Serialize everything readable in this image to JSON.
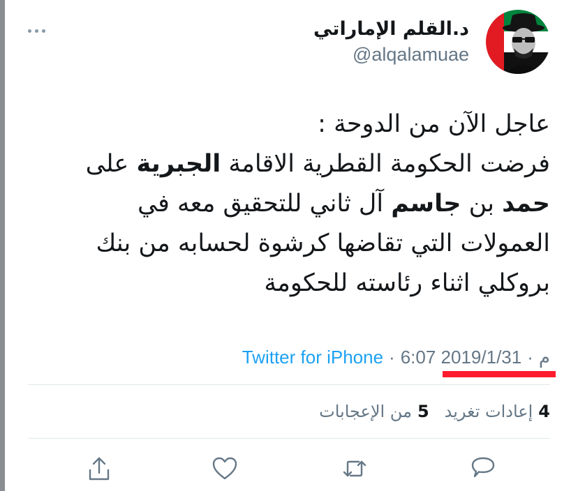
{
  "tweet": {
    "display_name": "د.القلم الإماراتي",
    "handle": "@alqalamuae",
    "text_lines": [
      [
        {
          "t": "عاجل الآن من الدوحة :",
          "b": false
        }
      ],
      [
        {
          "t": "فرضت الحكومة القطرية الاقامة ",
          "b": false
        },
        {
          "t": "الجبرية",
          "b": true
        },
        {
          "t": " على",
          "b": false
        }
      ],
      [
        {
          "t": "حمد",
          "b": true
        },
        {
          "t": " بن ",
          "b": false
        },
        {
          "t": "جاسم",
          "b": true
        },
        {
          "t": " آل ثاني للتحقيق معه في",
          "b": false
        }
      ],
      [
        {
          "t": "العمولات التي تقاضها كرشوة لحسابه من بنك",
          "b": false
        }
      ],
      [
        {
          "t": "بروكلي اثناء رئاسته للحكومة",
          "b": false
        }
      ]
    ],
    "meta": {
      "source": "Twitter for iPhone",
      "time": "6:07 م",
      "date": "2019/1/31",
      "separator": "·"
    },
    "stats": {
      "retweets_count": "4",
      "retweets_label": "إعادات تغريد",
      "likes_count": "5",
      "likes_label": "من الإعجابات"
    },
    "icons": {
      "more": "more-dots-icon",
      "reply": "reply-icon",
      "retweet": "retweet-icon",
      "like": "heart-icon",
      "share": "share-icon"
    },
    "colors": {
      "link": "#1da1f2",
      "secondary": "#657786",
      "highlight_underline": "#ff1b2d",
      "divider": "#e1e8ed"
    }
  }
}
